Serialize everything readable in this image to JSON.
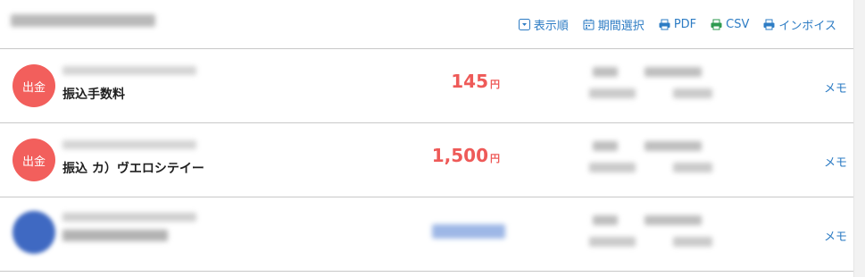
{
  "toolbar": {
    "sort_label": "表示順",
    "period_label": "期間選択",
    "pdf_label": "PDF",
    "csv_label": "CSV",
    "invoice_label": "インボイス"
  },
  "rows": [
    {
      "type_label": "出金",
      "description": "振込手数料",
      "amount": "145",
      "unit": "円",
      "memo_label": "メモ"
    },
    {
      "type_label": "出金",
      "description": "振込 カ）ヴエロシテイー",
      "amount": "1,500",
      "unit": "円",
      "memo_label": "メモ"
    },
    {
      "memo_label": "メモ"
    }
  ],
  "colors": {
    "accent_link": "#2d7cc4",
    "withdrawal_badge": "#f25f5c",
    "amount_text": "#ee5a58",
    "csv_icon": "#2e9a4f"
  },
  "icons": [
    "sort-icon",
    "calendar-icon",
    "printer-icon",
    "printer-icon",
    "printer-icon"
  ]
}
